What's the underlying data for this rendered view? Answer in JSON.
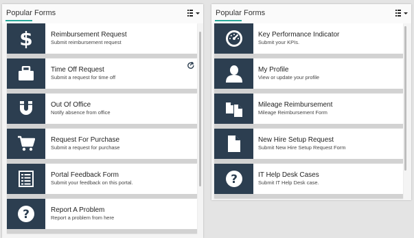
{
  "left_panel": {
    "title": "Popular Forms",
    "items": [
      {
        "title": "Reimbursement Request",
        "subtitle": "Submit reimbursement request",
        "icon": "dollar-icon"
      },
      {
        "title": "Time Off Request",
        "subtitle": "Submit a request for time off",
        "icon": "briefcase-icon"
      },
      {
        "title": "Out Of Office",
        "subtitle": "Notify absence from office",
        "icon": "magnet-icon"
      },
      {
        "title": "Request For Purchase",
        "subtitle": "Submit a request for purchase",
        "icon": "cart-icon"
      },
      {
        "title": "Portal Feedback Form",
        "subtitle": "Submit your feedback on this portal.",
        "icon": "list-icon"
      },
      {
        "title": "Report A Problem",
        "subtitle": "Report a problem from here",
        "icon": "question-icon"
      }
    ]
  },
  "right_panel": {
    "title": "Popular Forms",
    "items": [
      {
        "title": "Key Performance Indicator",
        "subtitle": "Submit your KPIs.",
        "icon": "gauge-icon"
      },
      {
        "title": "My Profile",
        "subtitle": "View or update your profile",
        "icon": "user-icon"
      },
      {
        "title": "Mileage Reimbursement",
        "subtitle": "Mileage Reimbursement Form",
        "icon": "files-icon"
      },
      {
        "title": "New Hire Setup Request",
        "subtitle": "Submit New Hire Setup Request Form",
        "icon": "document-icon"
      },
      {
        "title": "IT Help Desk Cases",
        "subtitle": "Submit IT Help Desk case.",
        "icon": "question-icon"
      }
    ]
  },
  "colors": {
    "icon_bg": "#2c3e50",
    "accent": "#29a99a"
  }
}
